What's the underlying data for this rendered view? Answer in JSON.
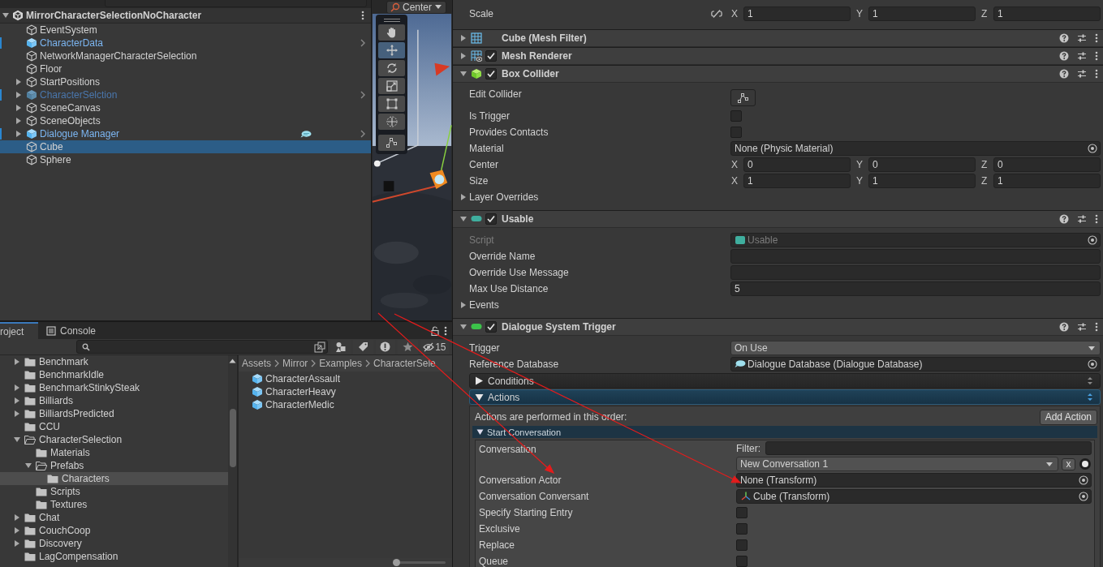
{
  "hierarchy": {
    "scene": {
      "name": "MirrorCharacterSelectionNoCharacter",
      "expanded": true,
      "children": [
        {
          "name": "EventSystem",
          "kind": "object",
          "inactive": false,
          "tagged": false,
          "selected": false
        },
        {
          "name": "CharacterData",
          "kind": "prefab",
          "inactive": false,
          "tagged": false,
          "selected": false
        },
        {
          "name": "NetworkManagerCharacterSelection",
          "kind": "object",
          "inactive": false,
          "tagged": false,
          "selected": false
        },
        {
          "name": "Floor",
          "kind": "object",
          "inactive": false,
          "tagged": false,
          "selected": false
        },
        {
          "name": "StartPositions",
          "kind": "object",
          "expanded": false,
          "inactive": false,
          "tagged": false,
          "selected": false
        },
        {
          "name": "CharacterSelction",
          "kind": "prefab",
          "expanded": false,
          "inactive": true,
          "tagged": false,
          "selected": false
        },
        {
          "name": "SceneCanvas",
          "kind": "object",
          "expanded": false,
          "inactive": false,
          "tagged": false,
          "selected": false
        },
        {
          "name": "SceneObjects",
          "kind": "object",
          "expanded": false,
          "inactive": false,
          "tagged": false,
          "selected": false
        },
        {
          "name": "Dialogue Manager",
          "kind": "prefab",
          "expanded": false,
          "inactive": false,
          "tagged": true,
          "selected": false
        },
        {
          "name": "Cube",
          "kind": "object",
          "inactive": false,
          "tagged": false,
          "selected": true
        },
        {
          "name": "Sphere",
          "kind": "object",
          "inactive": false,
          "tagged": false,
          "selected": false
        }
      ]
    }
  },
  "scene_view": {
    "pivot_dropdown": "Center",
    "tools": [
      {
        "kind": "hand",
        "selected": false
      },
      {
        "kind": "move",
        "selected": true
      },
      {
        "kind": "rotate",
        "selected": false
      },
      {
        "kind": "scale",
        "selected": false
      },
      {
        "kind": "rect",
        "selected": false
      },
      {
        "kind": "transform",
        "selected": false
      },
      {
        "kind": "custom",
        "selected": false
      }
    ]
  },
  "project": {
    "tabs": [
      {
        "label": "roject",
        "selected": true
      },
      {
        "label": "Console",
        "selected": false
      }
    ],
    "hidden_count": "15",
    "folders": [
      {
        "name": "Benchmark",
        "expanded": false,
        "selected": false
      },
      {
        "name": "BenchmarkIdle",
        "selected": false
      },
      {
        "name": "BenchmarkStinkySteak",
        "expanded": false,
        "selected": false
      },
      {
        "name": "Billiards",
        "expanded": false,
        "selected": false
      },
      {
        "name": "BilliardsPredicted",
        "expanded": false,
        "selected": false
      },
      {
        "name": "CCU",
        "selected": false
      },
      {
        "name": "CharacterSelection",
        "expanded": true,
        "selected": false,
        "children": [
          {
            "name": "Materials",
            "selected": false
          },
          {
            "name": "Prefabs",
            "expanded": true,
            "selected": false,
            "children": [
              {
                "name": "Characters",
                "selected": true
              }
            ]
          },
          {
            "name": "Scripts",
            "selected": false
          },
          {
            "name": "Textures",
            "selected": false
          }
        ]
      },
      {
        "name": "Chat",
        "expanded": false,
        "selected": false
      },
      {
        "name": "CouchCoop",
        "expanded": false,
        "selected": false
      },
      {
        "name": "Discovery",
        "expanded": false,
        "selected": false
      },
      {
        "name": "LagCompensation",
        "selected": false
      }
    ],
    "breadcrumb": [
      "Assets",
      "Mirror",
      "Examples",
      "CharacterSele"
    ],
    "assets": [
      "CharacterAssault",
      "CharacterHeavy",
      "CharacterMedic"
    ],
    "zoom_slider": {
      "level": 0.05
    }
  },
  "inspector": {
    "rows_above": [
      {
        "kind": "vector3",
        "label": "Scale",
        "constrained": false,
        "axes": [
          {
            "label": "X",
            "value": "1"
          },
          {
            "label": "Y",
            "value": "1"
          },
          {
            "label": "Z",
            "value": "1"
          }
        ]
      }
    ],
    "components": [
      {
        "title": "Cube (Mesh Filter)",
        "kind": "mesh_filter",
        "expanded": false
      },
      {
        "title": "Mesh Renderer",
        "kind": "mesh_renderer",
        "enabled": true,
        "expanded": false
      },
      {
        "title": "Box Collider",
        "kind": "box_collider",
        "enabled": true,
        "expanded": true,
        "rows": [
          {
            "kind": "edit_button",
            "label": "Edit Collider"
          },
          {
            "kind": "checkbox",
            "label": "Is Trigger",
            "checked": false
          },
          {
            "kind": "checkbox",
            "label": "Provides Contacts",
            "checked": false
          },
          {
            "kind": "object",
            "label": "Material",
            "value": "None (Physic Material)"
          },
          {
            "kind": "vector3",
            "label": "Center",
            "axes": [
              {
                "label": "X",
                "value": "0"
              },
              {
                "label": "Y",
                "value": "0"
              },
              {
                "label": "Z",
                "value": "0"
              }
            ]
          },
          {
            "kind": "vector3",
            "label": "Size",
            "axes": [
              {
                "label": "X",
                "value": "1"
              },
              {
                "label": "Y",
                "value": "1"
              },
              {
                "label": "Z",
                "value": "1"
              }
            ]
          },
          {
            "kind": "foldout",
            "label": "Layer Overrides",
            "expanded": false
          }
        ]
      },
      {
        "title": "Usable",
        "kind": "script",
        "color": "#3fae9e",
        "enabled": true,
        "expanded": true,
        "rows": [
          {
            "kind": "script_ref",
            "label": "Script",
            "value": "Usable",
            "disabled": true
          },
          {
            "kind": "text",
            "label": "Override Name"
          },
          {
            "kind": "text",
            "label": "Override Use Message"
          },
          {
            "kind": "text",
            "label": "Max Use Distance",
            "value": "5"
          },
          {
            "kind": "foldout",
            "label": "Events",
            "expanded": false
          }
        ]
      },
      {
        "title": "Dialogue System Trigger",
        "kind": "script",
        "color": "#3cc24a",
        "enabled": true,
        "expanded": true,
        "rows": [
          {
            "kind": "dropdown",
            "label": "Trigger",
            "value": "On Use"
          },
          {
            "kind": "database_ref",
            "label": "Reference Database",
            "value": "Dialogue Database (Dialogue Database)"
          },
          {
            "kind": "section",
            "label": "Conditions",
            "expanded": false
          },
          {
            "kind": "section",
            "label": "Actions",
            "expanded": true,
            "note": "Actions are performed in this order:",
            "button": "Add Action",
            "actions": [
              {
                "title": "Start Conversation",
                "expanded": true,
                "rows": [
                  {
                    "kind": "conversation",
                    "label": "Conversation",
                    "filter_label": "Filter:",
                    "value": "New Conversation 1",
                    "clear_button": "x"
                  },
                  {
                    "kind": "object",
                    "label": "Conversation Actor",
                    "value": "None (Transform)"
                  },
                  {
                    "kind": "transform_ref",
                    "label": "Conversation Conversant",
                    "value": "Cube (Transform)"
                  },
                  {
                    "kind": "checkbox",
                    "label": "Specify Starting Entry",
                    "checked": false
                  },
                  {
                    "kind": "checkbox",
                    "label": "Exclusive",
                    "checked": false
                  },
                  {
                    "kind": "checkbox",
                    "label": "Replace",
                    "checked": false
                  },
                  {
                    "kind": "checkbox",
                    "label": "Queue",
                    "checked": false
                  }
                ]
              }
            ]
          }
        ]
      }
    ]
  }
}
